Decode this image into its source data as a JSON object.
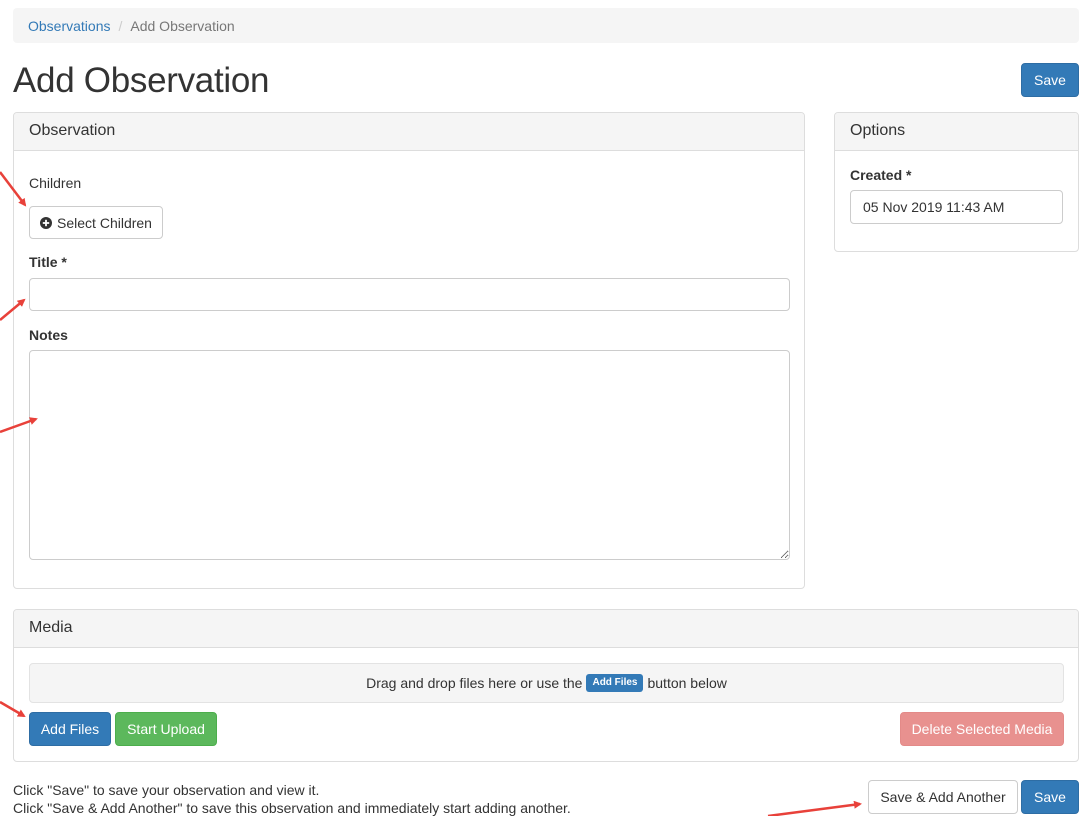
{
  "breadcrumb": {
    "parent": "Observations",
    "separator": "/",
    "current": "Add Observation"
  },
  "page": {
    "title": "Add Observation",
    "save_label": "Save"
  },
  "observation_panel": {
    "heading": "Observation",
    "children_label": "Children",
    "select_children_label": "Select Children",
    "title_label": "Title *",
    "title_value": "",
    "notes_label": "Notes",
    "notes_value": ""
  },
  "options_panel": {
    "heading": "Options",
    "created_label": "Created *",
    "created_value": "05 Nov 2019 11:43 AM"
  },
  "media_panel": {
    "heading": "Media",
    "drop_text_before": "Drag and drop files here or use the",
    "drop_button": "Add Files",
    "drop_text_after": "button below",
    "add_files_label": "Add Files",
    "start_upload_label": "Start Upload",
    "delete_label": "Delete Selected Media"
  },
  "footer": {
    "help_line_1": "Click \"Save\" to save your observation and view it.",
    "help_line_2": "Click \"Save & Add Another\" to save this observation and immediately start adding another.",
    "save_add_another_label": "Save & Add Another",
    "save_label": "Save"
  },
  "colors": {
    "primary": "#337ab7",
    "success": "#5cb85c",
    "danger_disabled": "#e8918f",
    "annotation_arrow": "#e8413a"
  }
}
